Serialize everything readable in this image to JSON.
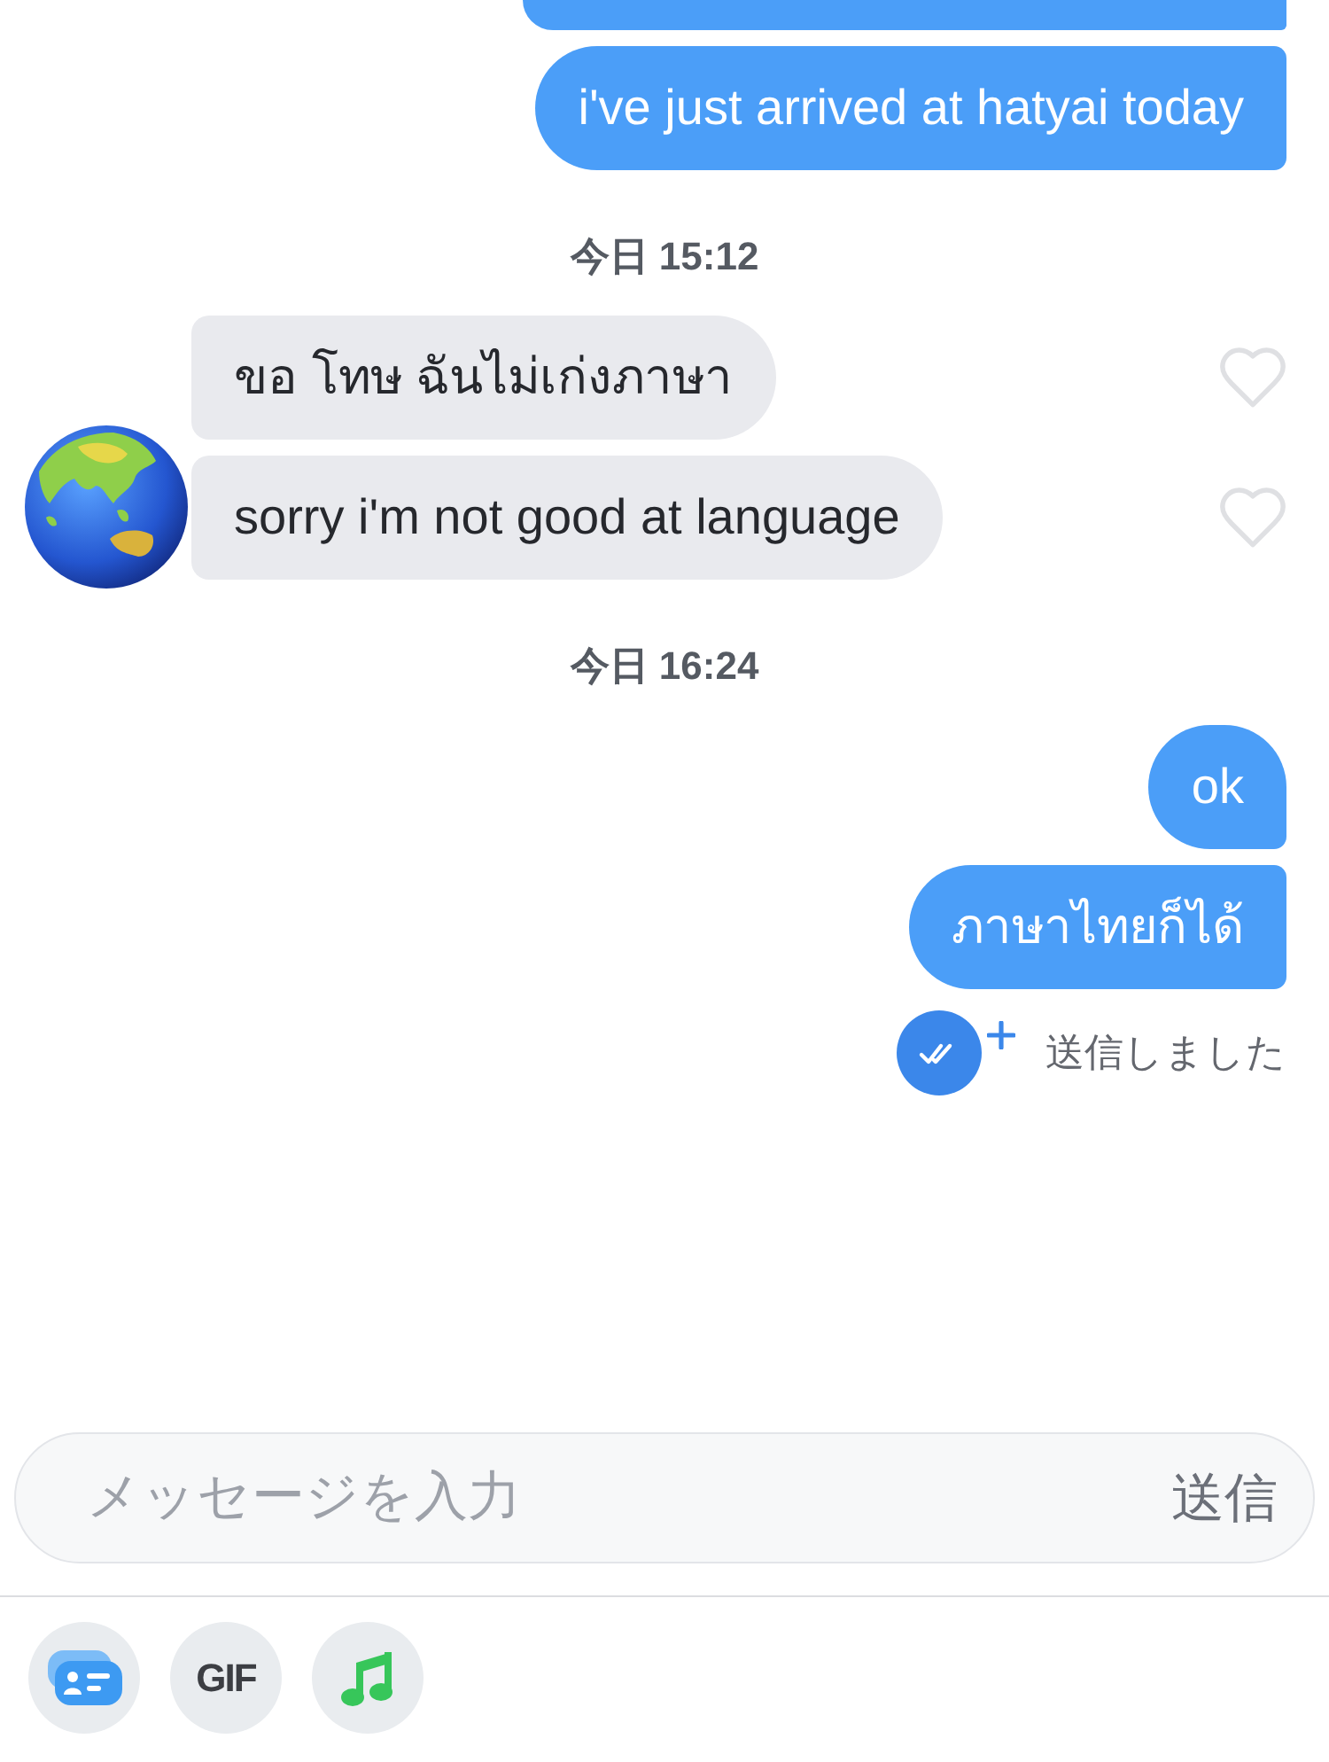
{
  "conversation": [
    {
      "kind": "outgoing",
      "messages": [
        {
          "kind": "cut_off"
        },
        {
          "kind": "text",
          "text": "i've just arrived at hatyai today"
        }
      ]
    },
    {
      "kind": "timestamp",
      "text": "今日 15:12"
    },
    {
      "kind": "incoming",
      "messages": [
        {
          "text": "ขอ โทษ ฉันไม่เก่งภาษา",
          "liked": false
        },
        {
          "text": "sorry i'm not good at language",
          "liked": false
        }
      ]
    },
    {
      "kind": "timestamp",
      "text": "今日 16:24"
    },
    {
      "kind": "outgoing",
      "messages": [
        {
          "kind": "text",
          "text": "ok"
        },
        {
          "kind": "text",
          "text": "ภาษาไทยก็ได้"
        }
      ],
      "status": {
        "text": "送信しました"
      }
    }
  ],
  "composer": {
    "placeholder": "メッセージを入力",
    "send_label": "送信"
  },
  "toolbar": [
    {
      "kind": "cards"
    },
    {
      "kind": "gif",
      "label": "GIF"
    },
    {
      "kind": "music"
    }
  ]
}
